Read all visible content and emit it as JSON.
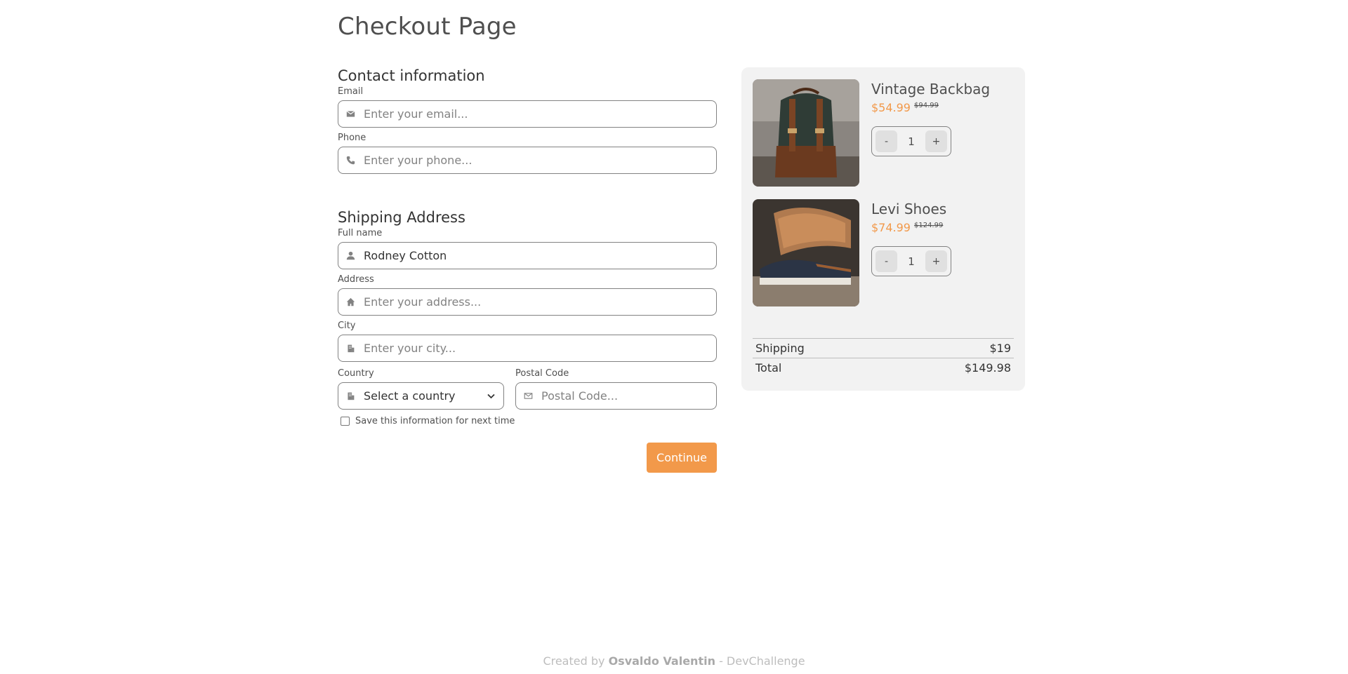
{
  "page": {
    "title": "Checkout Page"
  },
  "contact": {
    "heading": "Contact information",
    "email_label": "Email",
    "email_placeholder": "Enter your email...",
    "email_icon": "envelope-icon",
    "phone_label": "Phone",
    "phone_placeholder": "Enter your phone...",
    "phone_icon": "phone-icon"
  },
  "shipping": {
    "heading": "Shipping Address",
    "fullname_label": "Full name",
    "fullname_value": "Rodney Cotton",
    "address_label": "Address",
    "address_placeholder": "Enter your address...",
    "city_label": "City",
    "city_placeholder": "Enter your city...",
    "country_label": "Country",
    "country_value": "Select a country",
    "postal_label": "Postal Code",
    "postal_placeholder": "Postal Code...",
    "save_label": "Save this information for next time",
    "save_checked": false
  },
  "continue_label": "Continue",
  "cart": {
    "items": [
      {
        "name": "Vintage Backbag",
        "price": "$54.99",
        "old_price": "$94.99",
        "quantity": "1",
        "minus": "-",
        "plus": "+"
      },
      {
        "name": "Levi Shoes",
        "price": "$74.99",
        "old_price": "$124.99",
        "quantity": "1",
        "minus": "-",
        "plus": "+"
      }
    ],
    "shipping_label": "Shipping",
    "shipping_value": "$19",
    "total_label": "Total",
    "total_value": "$149.98"
  },
  "footer": {
    "prefix": "Created by",
    "author": "Osvaldo Valentin",
    "suffix": "- DevChallenge"
  },
  "colors": {
    "accent": "#F2994A",
    "card_bg": "#F2F2F2",
    "border": "#828282"
  }
}
